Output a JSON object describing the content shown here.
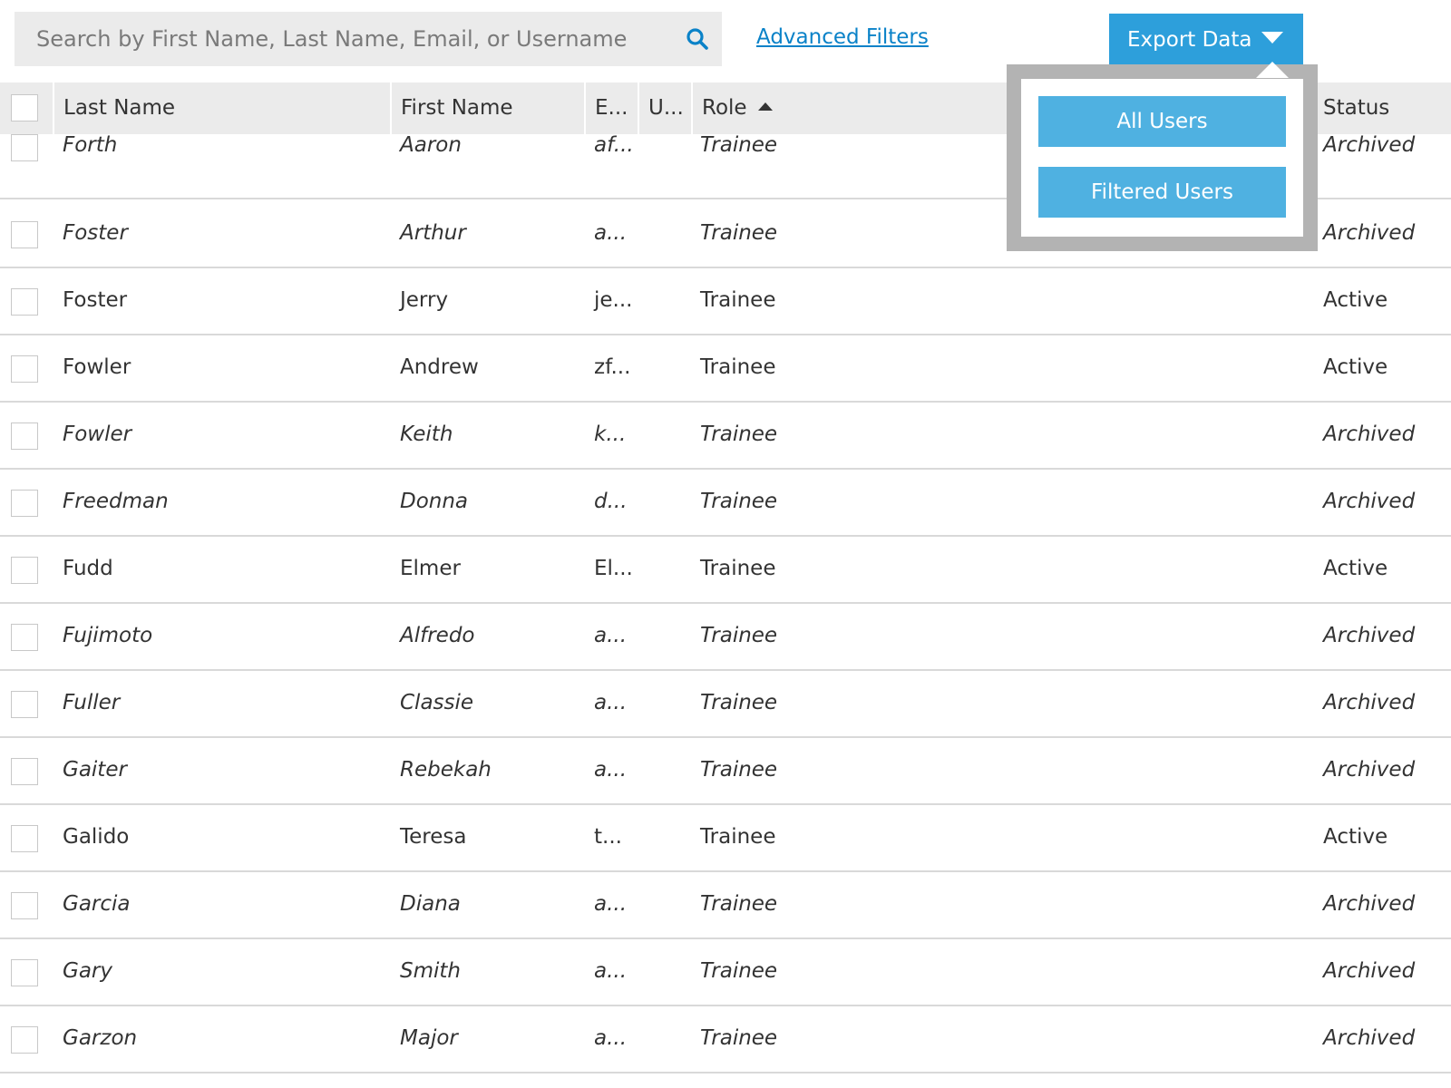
{
  "search": {
    "placeholder": "Search by First Name, Last Name, Email, or Username"
  },
  "toolbar": {
    "advanced_filters": "Advanced Filters",
    "export_label": "Export Data"
  },
  "export_menu": {
    "items": [
      "All Users",
      "Filtered Users"
    ]
  },
  "table": {
    "columns": {
      "last_name": "Last Name",
      "first_name": "First Name",
      "email": "E...",
      "username": "U...",
      "role": "Role",
      "status": "Status"
    },
    "sort": {
      "column": "Role",
      "direction": "ascending"
    },
    "rows": [
      {
        "last": "Forth",
        "first": "Aaron",
        "email": "af...",
        "role": "Trainee",
        "status": "Archived"
      },
      {
        "last": "Foster",
        "first": "Arthur",
        "email": "a...",
        "role": "Trainee",
        "status": "Archived"
      },
      {
        "last": "Foster",
        "first": "Jerry",
        "email": "je...",
        "role": "Trainee",
        "status": "Active"
      },
      {
        "last": "Fowler",
        "first": "Andrew",
        "email": "zf...",
        "role": "Trainee",
        "status": "Active"
      },
      {
        "last": "Fowler",
        "first": "Keith",
        "email": "k...",
        "role": "Trainee",
        "status": "Archived"
      },
      {
        "last": "Freedman",
        "first": "Donna",
        "email": "d...",
        "role": "Trainee",
        "status": "Archived"
      },
      {
        "last": "Fudd",
        "first": "Elmer",
        "email": "El...",
        "role": "Trainee",
        "status": "Active"
      },
      {
        "last": "Fujimoto",
        "first": "Alfredo",
        "email": "a...",
        "role": "Trainee",
        "status": "Archived"
      },
      {
        "last": "Fuller",
        "first": "Classie",
        "email": "a...",
        "role": "Trainee",
        "status": "Archived"
      },
      {
        "last": "Gaiter",
        "first": "Rebekah",
        "email": "a...",
        "role": "Trainee",
        "status": "Archived"
      },
      {
        "last": "Galido",
        "first": "Teresa",
        "email": "t...",
        "role": "Trainee",
        "status": "Active"
      },
      {
        "last": "Garcia",
        "first": "Diana",
        "email": "a...",
        "role": "Trainee",
        "status": "Archived"
      },
      {
        "last": "Gary",
        "first": "Smith",
        "email": "a...",
        "role": "Trainee",
        "status": "Archived"
      },
      {
        "last": "Garzon",
        "first": "Major",
        "email": "a...",
        "role": "Trainee",
        "status": "Archived"
      }
    ]
  },
  "colors": {
    "accent": "#2d9fdb",
    "menu_button": "#4fb1e1",
    "link": "#0a82c8",
    "header_bg": "#ebebeb"
  },
  "icons": {
    "search": "search-icon",
    "export_caret": "caret-down-icon",
    "sort": "sort-ascending-icon"
  }
}
